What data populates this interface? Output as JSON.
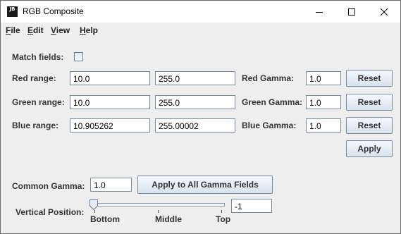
{
  "window": {
    "title": "RGB Composite",
    "icon_text": "JB",
    "icon_text_2": "■",
    "controls": [
      "minimize-icon",
      "maximize-icon",
      "close-icon"
    ]
  },
  "menu": {
    "items": [
      {
        "label_mnemonic": "F",
        "label_rest": "ile"
      },
      {
        "label_mnemonic": "E",
        "label_rest": "dit"
      },
      {
        "label_mnemonic": "V",
        "label_rest": "iew"
      },
      {
        "label_mnemonic": "H",
        "label_rest": "elp"
      }
    ]
  },
  "match_fields": {
    "label": "Match fields:",
    "checked": false
  },
  "rows": [
    {
      "label": "Red range:",
      "min": "10.0",
      "max": "255.0",
      "gamma_label": "Red Gamma:",
      "gamma": "1.0",
      "reset": "Reset"
    },
    {
      "label": "Green range:",
      "min": "10.0",
      "max": "255.0",
      "gamma_label": "Green Gamma:",
      "gamma": "1.0",
      "reset": "Reset"
    },
    {
      "label": "Blue range:",
      "min": "10.905262",
      "max": "255.00002",
      "gamma_label": "Blue Gamma:",
      "gamma": "1.0",
      "reset": "Reset"
    }
  ],
  "apply_label": "Apply",
  "common_gamma": {
    "label": "Common Gamma:",
    "value": "1.0",
    "apply_all_label": "Apply to All Gamma Fields"
  },
  "vertical_position": {
    "label": "Vertical Position:",
    "value": "-1",
    "tick_labels": [
      "Bottom",
      "Middle",
      "Top"
    ],
    "slider_fraction": 0.0
  },
  "colors": {
    "accent_border": "#7a8a99",
    "background": "#eeeeee"
  }
}
